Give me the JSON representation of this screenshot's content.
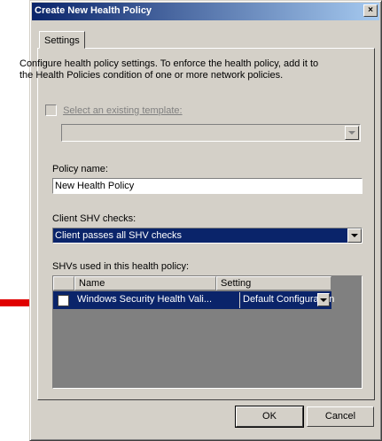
{
  "window": {
    "title": "Create New Health Policy",
    "close_glyph": "×"
  },
  "tabs": [
    {
      "label": "Settings"
    }
  ],
  "settings": {
    "description": "Configure health policy settings. To enforce the health policy, add it to the Health Policies condition of one or more network policies.",
    "template_checkbox_label": "Select an existing template:",
    "policy_name_label": "Policy name:",
    "policy_name_value": "New Health Policy",
    "client_shv_label": "Client SHV checks:",
    "client_shv_value": "Client passes all SHV checks",
    "shvs_label": "SHVs used in this health policy:",
    "shv_table": {
      "headers": [
        "Name",
        "Setting"
      ],
      "rows": [
        {
          "name": "Windows Security Health Vali...",
          "setting": "Default Configuration"
        }
      ]
    }
  },
  "buttons": {
    "ok": "OK",
    "cancel": "Cancel"
  },
  "colors": {
    "selection": "#0a246a",
    "arrow": "#e00000",
    "face": "#d4d0c8"
  }
}
